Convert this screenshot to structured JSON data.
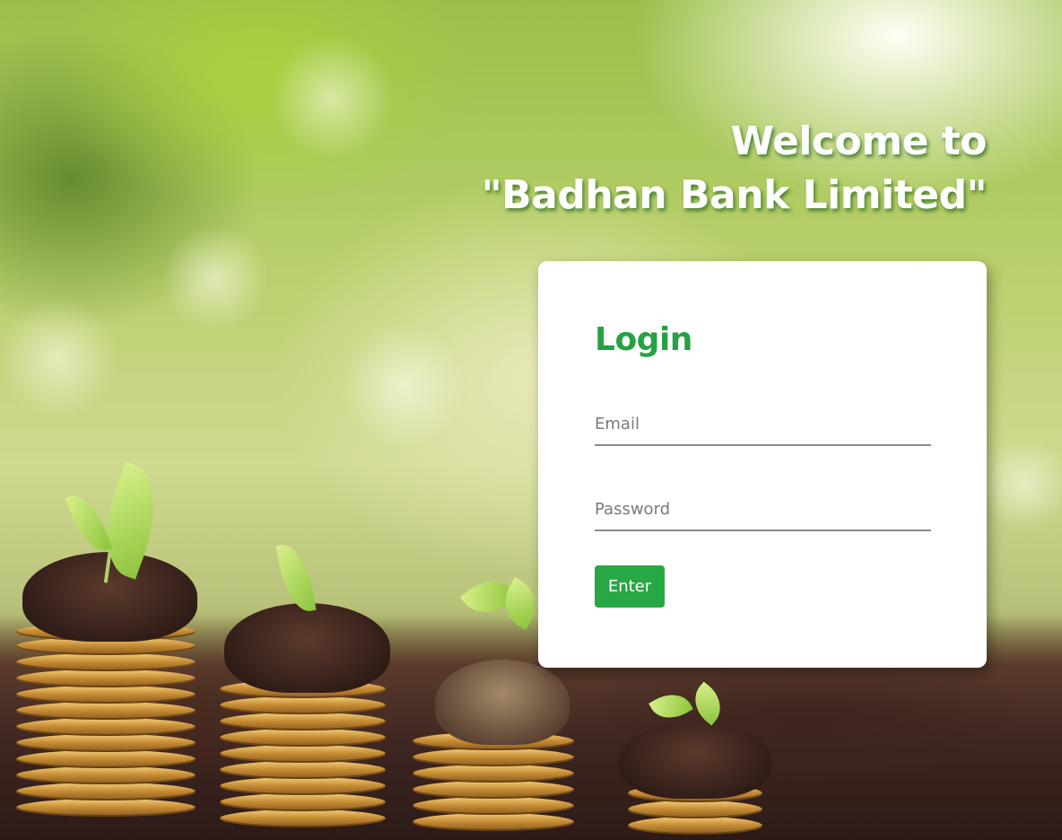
{
  "welcome": {
    "line1": "Welcome to",
    "line2": "\"Badhan Bank Limited\""
  },
  "login_card": {
    "title": "Login",
    "email_placeholder": "Email",
    "email_value": "",
    "password_placeholder": "Password",
    "password_value": "",
    "enter_button_label": "Enter"
  },
  "colors": {
    "accent_green": "#28a745",
    "title_green": "#25a244"
  }
}
